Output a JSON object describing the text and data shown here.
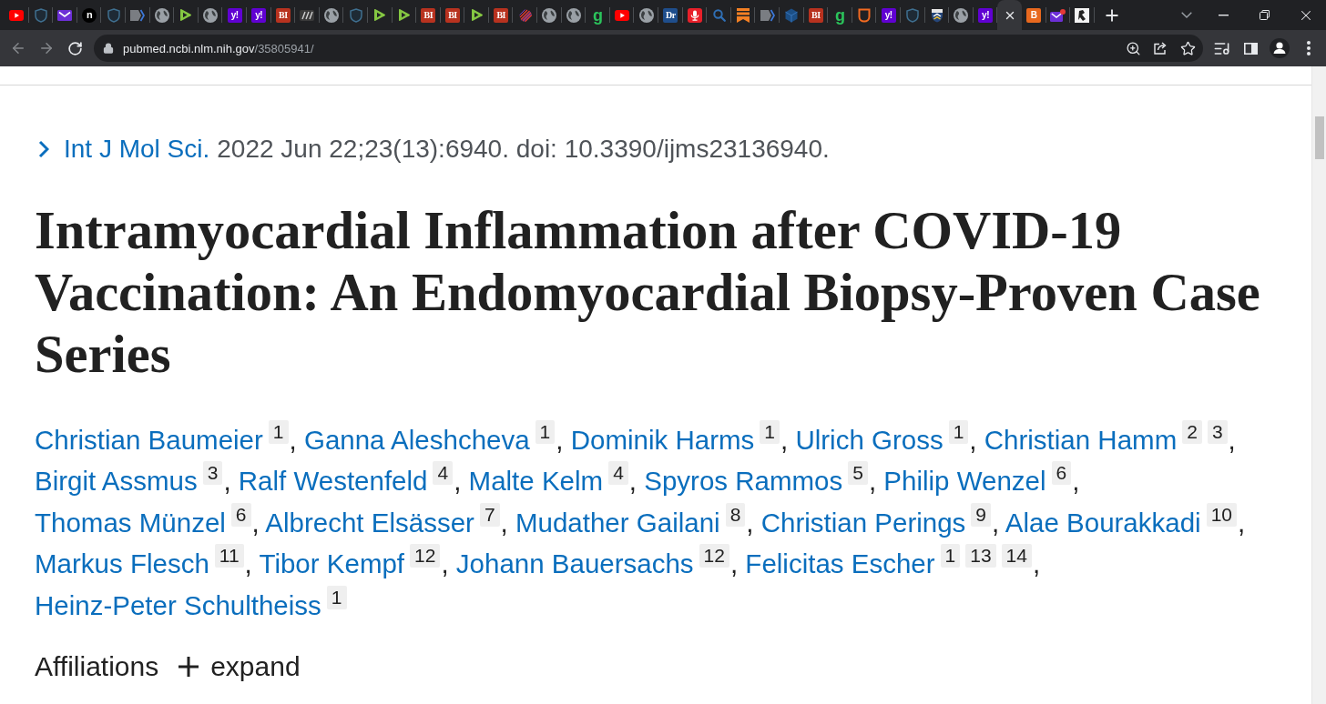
{
  "browser": {
    "tabs": [
      {
        "kind": "video",
        "selected": false
      },
      {
        "kind": "shield",
        "selected": false
      },
      {
        "kind": "mail",
        "selected": false
      },
      {
        "kind": "disc",
        "glyph": "n",
        "selected": false
      },
      {
        "kind": "shield",
        "selected": false
      },
      {
        "kind": "chevron",
        "selected": false
      },
      {
        "kind": "globe",
        "selected": false
      },
      {
        "kind": "play",
        "selected": false
      },
      {
        "kind": "globe",
        "selected": false
      },
      {
        "kind": "tile",
        "glyph": "y!",
        "color": "#6001d2",
        "selected": false
      },
      {
        "kind": "tile",
        "glyph": "y!",
        "color": "#6001d2",
        "selected": false
      },
      {
        "kind": "serif",
        "glyph": "BI",
        "color": "#b8321f",
        "selected": false
      },
      {
        "kind": "slashes",
        "selected": false
      },
      {
        "kind": "globe",
        "selected": false
      },
      {
        "kind": "shield",
        "selected": false
      },
      {
        "kind": "play",
        "selected": false
      },
      {
        "kind": "play",
        "selected": false
      },
      {
        "kind": "serif",
        "glyph": "BI",
        "color": "#b8321f",
        "selected": false
      },
      {
        "kind": "serif",
        "glyph": "BI",
        "color": "#b8321f",
        "selected": false
      },
      {
        "kind": "play",
        "selected": false
      },
      {
        "kind": "serif",
        "glyph": "BI",
        "color": "#b8321f",
        "selected": false
      },
      {
        "kind": "rays",
        "selected": false
      },
      {
        "kind": "globe",
        "selected": false
      },
      {
        "kind": "globe",
        "selected": false
      },
      {
        "kind": "letter",
        "glyph": "g",
        "color": "#2bc35b",
        "selected": false
      },
      {
        "kind": "video",
        "selected": false
      },
      {
        "kind": "globe",
        "selected": false
      },
      {
        "kind": "serif",
        "glyph": "Dr",
        "color": "#1f4e8c",
        "selected": false
      },
      {
        "kind": "mic",
        "selected": false
      },
      {
        "kind": "search",
        "selected": false
      },
      {
        "kind": "bookmark",
        "selected": false
      },
      {
        "kind": "chevron",
        "selected": false
      },
      {
        "kind": "cube",
        "selected": false
      },
      {
        "kind": "serif",
        "glyph": "BI",
        "color": "#b8321f",
        "selected": false
      },
      {
        "kind": "letter",
        "glyph": "g",
        "color": "#2bc35b",
        "selected": false
      },
      {
        "kind": "outline",
        "selected": false
      },
      {
        "kind": "tile",
        "glyph": "y!",
        "color": "#6001d2",
        "selected": false
      },
      {
        "kind": "shield",
        "selected": false
      },
      {
        "kind": "crest",
        "selected": false
      },
      {
        "kind": "globe",
        "selected": false
      },
      {
        "kind": "tile",
        "glyph": "y!",
        "color": "#6001d2",
        "selected": false
      },
      {
        "selected": true
      },
      {
        "kind": "tile",
        "glyph": "B",
        "color": "#e8681e",
        "selected": false
      },
      {
        "kind": "notify",
        "selected": false
      },
      {
        "kind": "sketch",
        "selected": false
      }
    ]
  },
  "toolbar": {
    "back": {
      "disabled": true
    },
    "forward": {
      "disabled": true
    },
    "url": {
      "host": "pubmed.ncbi.nlm.nih.gov",
      "path": "/35805941/"
    },
    "bookmarked": false
  },
  "article": {
    "citation": {
      "journal": "Int J Mol Sci.",
      "details": "2022 Jun 22;23(13):6940. doi: 10.3390/ijms23136940."
    },
    "title": "Intramyocardial Inflammation after COVID-19 Vaccination: An Endomyocardial Biopsy-Proven Case Series",
    "authors": [
      {
        "name": "Christian Baumeier",
        "affiliations": [
          "1"
        ],
        "separator": ","
      },
      {
        "name": "Ganna Aleshcheva",
        "affiliations": [
          "1"
        ],
        "separator": ","
      },
      {
        "name": "Dominik Harms",
        "affiliations": [
          "1"
        ],
        "separator": ","
      },
      {
        "name": "Ulrich Gross",
        "affiliations": [
          "1"
        ],
        "separator": ","
      },
      {
        "name": "Christian Hamm",
        "affiliations": [
          "2",
          "3"
        ],
        "separator": ","
      },
      {
        "name": "Birgit Assmus",
        "affiliations": [
          "3"
        ],
        "separator": ","
      },
      {
        "name": "Ralf Westenfeld",
        "affiliations": [
          "4"
        ],
        "separator": ","
      },
      {
        "name": "Malte Kelm",
        "affiliations": [
          "4"
        ],
        "separator": ","
      },
      {
        "name": "Spyros Rammos",
        "affiliations": [
          "5"
        ],
        "separator": ","
      },
      {
        "name": "Philip Wenzel",
        "affiliations": [
          "6"
        ],
        "separator": ","
      },
      {
        "name": "Thomas Münzel",
        "affiliations": [
          "6"
        ],
        "separator": ","
      },
      {
        "name": "Albrecht Elsässer",
        "affiliations": [
          "7"
        ],
        "separator": ","
      },
      {
        "name": "Mudather Gailani",
        "affiliations": [
          "8"
        ],
        "separator": ","
      },
      {
        "name": "Christian Perings",
        "affiliations": [
          "9"
        ],
        "separator": ","
      },
      {
        "name": "Alae Bourakkadi",
        "affiliations": [
          "10"
        ],
        "separator": ","
      },
      {
        "name": "Markus Flesch",
        "affiliations": [
          "11"
        ],
        "separator": ","
      },
      {
        "name": "Tibor Kempf",
        "affiliations": [
          "12"
        ],
        "separator": ","
      },
      {
        "name": "Johann Bauersachs",
        "affiliations": [
          "12"
        ],
        "separator": ","
      },
      {
        "name": "Felicitas Escher",
        "affiliations": [
          "1",
          "13",
          "14"
        ],
        "separator": ","
      },
      {
        "name": "Heinz-Peter Schultheiss",
        "affiliations": [
          "1"
        ]
      }
    ],
    "affiliations": {
      "label": "Affiliations",
      "toggle": "expand",
      "expanded": false
    }
  }
}
